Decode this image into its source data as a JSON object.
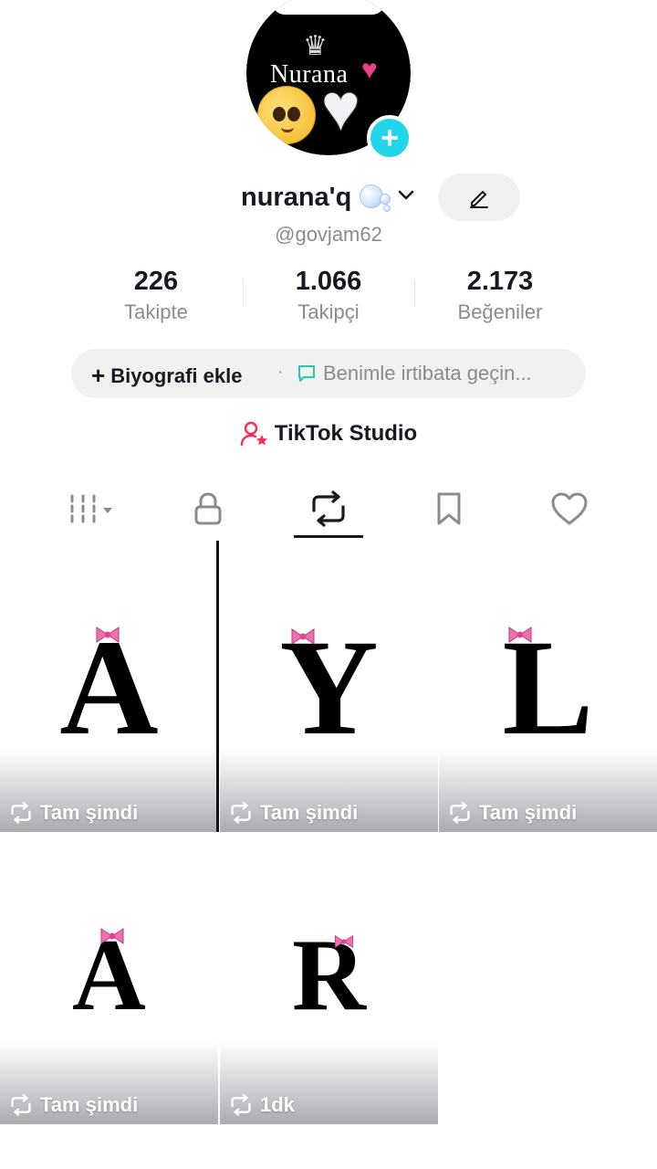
{
  "profile": {
    "avatar_text": "Nurana",
    "display_name": "nurana'q",
    "handle": "@govjam62",
    "add_icon": "plus-icon",
    "edit_icon": "pencil-icon"
  },
  "stats": [
    {
      "value": "226",
      "label": "Takipte"
    },
    {
      "value": "1.066",
      "label": "Takipçi"
    },
    {
      "value": "2.173",
      "label": "Beğeniler"
    }
  ],
  "bio": {
    "add_label": "Biyografi ekle",
    "separator": "·",
    "contact_label": "Benimle irtibata geçin..."
  },
  "studio": {
    "label": "TikTok Studio",
    "accent": "#fe2c55"
  },
  "tabs": [
    {
      "name": "grid-tab",
      "icon": "grid-icon"
    },
    {
      "name": "private-tab",
      "icon": "lock-icon"
    },
    {
      "name": "reposts-tab",
      "icon": "repost-icon",
      "active": true
    },
    {
      "name": "favorites-tab",
      "icon": "bookmark-icon"
    },
    {
      "name": "liked-tab",
      "icon": "heart-icon"
    }
  ],
  "videos": [
    {
      "letter": "A",
      "time": "Tam şimdi"
    },
    {
      "letter": "Y",
      "time": "Tam şimdi"
    },
    {
      "letter": "L",
      "time": "Tam şimdi"
    },
    {
      "letter": "A",
      "time": "Tam şimdi"
    },
    {
      "letter": "R",
      "time": "1dk"
    }
  ],
  "colors": {
    "add_button": "#20d5ec",
    "bow": "#f06fb0",
    "text_primary": "#161823",
    "text_secondary": "#8a8b91"
  }
}
